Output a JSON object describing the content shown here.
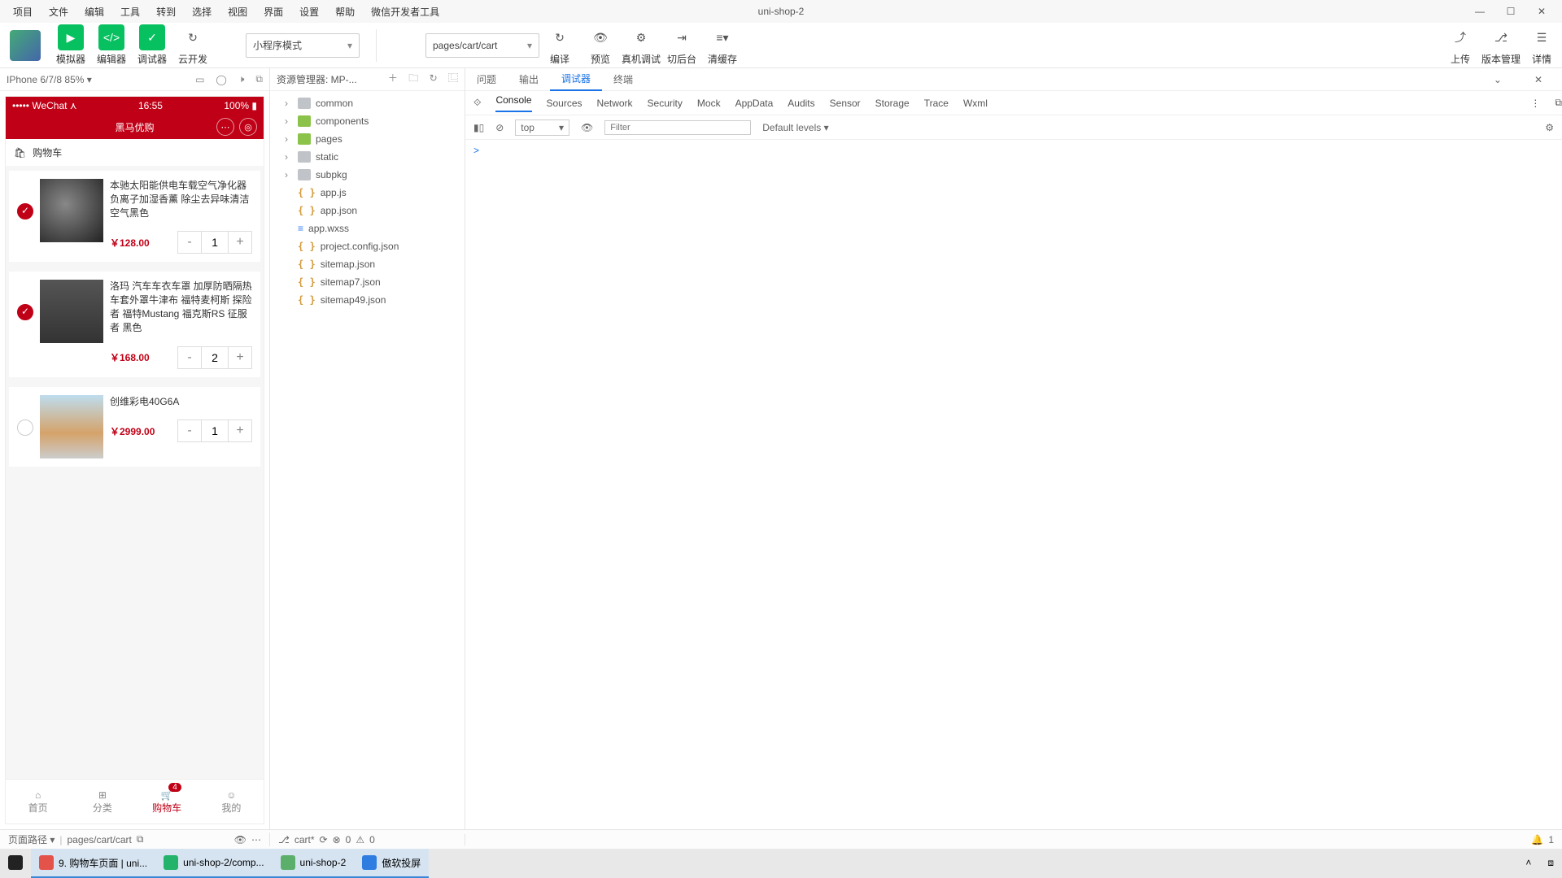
{
  "menu": [
    "项目",
    "文件",
    "编辑",
    "工具",
    "转到",
    "选择",
    "视图",
    "界面",
    "设置",
    "帮助",
    "微信开发者工具"
  ],
  "app_title": "uni-shop-2",
  "win": {
    "min": "—",
    "max": "☐",
    "close": "✕"
  },
  "toolbar": {
    "tabs": [
      {
        "label": "模拟器",
        "icon": "▶",
        "style": "green"
      },
      {
        "label": "编辑器",
        "icon": "</>",
        "style": "green"
      },
      {
        "label": "调试器",
        "icon": "✓",
        "style": "green"
      },
      {
        "label": "云开发",
        "icon": "↻",
        "style": "plain"
      }
    ],
    "mode_select": "小程序模式",
    "page_select": "pages/cart/cart",
    "actions": [
      {
        "label": "编译",
        "icon": "↻"
      },
      {
        "label": "预览",
        "icon": "👁"
      },
      {
        "label": "真机调试",
        "icon": "⚙"
      },
      {
        "label": "切后台",
        "icon": "⇥"
      },
      {
        "label": "清缓存",
        "icon": "≡▾"
      }
    ],
    "right": [
      {
        "label": "上传",
        "icon": "⤴"
      },
      {
        "label": "版本管理",
        "icon": "⎇"
      },
      {
        "label": "详情",
        "icon": "☰"
      }
    ]
  },
  "simulator": {
    "device": "IPhone 6/7/8 85% ▾",
    "status_left": "••••• WeChat ⋏",
    "status_time": "16:55",
    "status_right": "100% ▮",
    "nav_title": "黑马优购",
    "cart_header": "购物车",
    "items": [
      {
        "checked": true,
        "name": "本驰太阳能供电车载空气净化器负离子加湿香薰 除尘去异味清洁空气黑色",
        "price": "￥128.00",
        "qty": "1"
      },
      {
        "checked": true,
        "name": "洛玛 汽车车衣车罩 加厚防晒隔热车套外罩牛津布 福特麦柯斯 探险者 福特Mustang 福克斯RS 征服者 黑色",
        "price": "￥168.00",
        "qty": "2"
      },
      {
        "checked": false,
        "name": "创维彩电40G6A",
        "price": "￥2999.00",
        "qty": "1"
      }
    ],
    "tabs": [
      {
        "label": "首页",
        "icon": "⌂"
      },
      {
        "label": "分类",
        "icon": "⊞"
      },
      {
        "label": "购物车",
        "icon": "🛒",
        "badge": "4",
        "active": true
      },
      {
        "label": "我的",
        "icon": "☺"
      }
    ],
    "minus": "-",
    "plus": "+"
  },
  "tree": {
    "title": "资源管理器: MP-...",
    "folders": [
      "common",
      "components",
      "pages",
      "static",
      "subpkg"
    ],
    "files": [
      "app.js",
      "app.json",
      "app.wxss",
      "project.config.json",
      "sitemap.json",
      "sitemap7.json",
      "sitemap49.json"
    ]
  },
  "devtools": {
    "tabs1": [
      "问题",
      "输出",
      "调试器",
      "终端"
    ],
    "tabs1_active": "调试器",
    "tabs2": [
      "Console",
      "Sources",
      "Network",
      "Security",
      "Mock",
      "AppData",
      "Audits",
      "Sensor",
      "Storage",
      "Trace",
      "Wxml"
    ],
    "tabs2_active": "Console",
    "context": "top",
    "filter_ph": "Filter",
    "levels": "Default levels ▾",
    "prompt": ">"
  },
  "status": {
    "left_label": "页面路径 ▾",
    "path": "pages/cart/cart",
    "branch": "cart*",
    "err": "0",
    "warn": "0",
    "notif": "1"
  },
  "taskbar": [
    {
      "label": "",
      "color": "#fff",
      "icon": "⊞"
    },
    {
      "label": "9. 购物车页面 | uni...",
      "color": "#fff",
      "active": true,
      "icon_bg": "#e3534a"
    },
    {
      "label": "uni-shop-2/comp...",
      "color": "#fff",
      "active": true,
      "icon_bg": "#24b36b"
    },
    {
      "label": "uni-shop-2",
      "color": "#fff",
      "active": true,
      "icon_bg": "#5caf6a"
    },
    {
      "label": "傲软投屏",
      "color": "#fff",
      "active": true,
      "icon_bg": "#2f7de1"
    }
  ],
  "tray": {
    "up": "˄",
    "act": "⧈"
  }
}
